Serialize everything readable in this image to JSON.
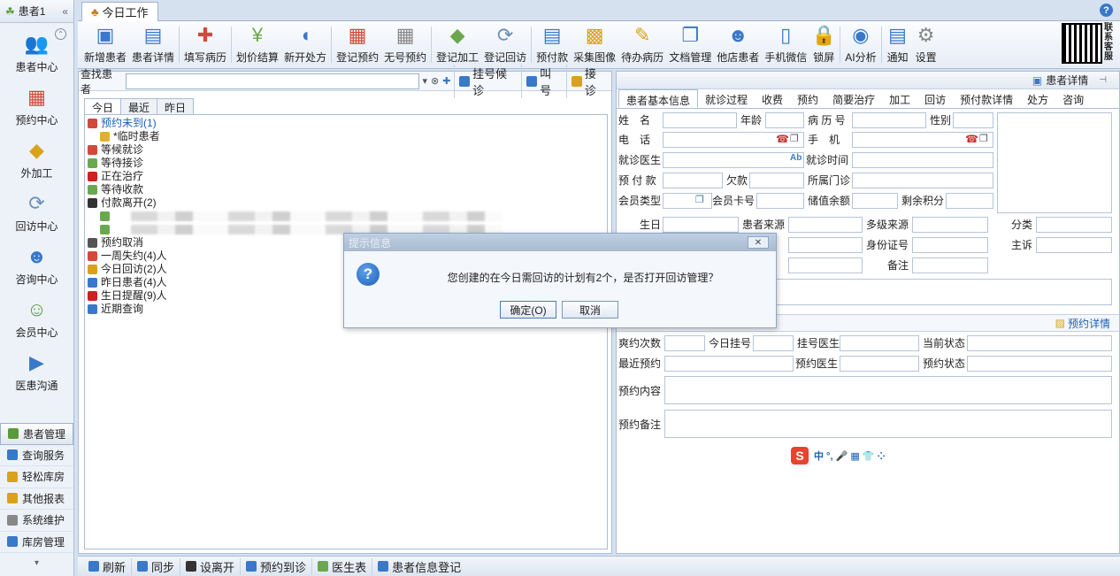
{
  "sidebar": {
    "header": "患者1",
    "collapse": "«",
    "big_items": [
      {
        "label": "患者中心",
        "icon": "patients-icon"
      },
      {
        "label": "预约中心",
        "icon": "calendar-icon"
      },
      {
        "label": "外加工",
        "icon": "boxes-icon"
      },
      {
        "label": "回访中心",
        "icon": "refresh-icon"
      },
      {
        "label": "咨询中心",
        "icon": "consultant-icon"
      },
      {
        "label": "会员中心",
        "icon": "members-icon"
      },
      {
        "label": "医患沟通",
        "icon": "video-icon"
      }
    ],
    "small_items": [
      {
        "label": "患者管理",
        "color": "#5b9a3c",
        "active": true
      },
      {
        "label": "查询服务",
        "color": "#3a78c9",
        "active": false
      },
      {
        "label": "轻松库房",
        "color": "#d9a21a",
        "active": false
      },
      {
        "label": "其他报表",
        "color": "#d9a21a",
        "active": false
      },
      {
        "label": "系统维护",
        "color": "#888888",
        "active": false
      },
      {
        "label": "库房管理",
        "color": "#3a78c9",
        "active": false
      }
    ]
  },
  "tab": {
    "label": "今日工作"
  },
  "toolbar": {
    "buttons": [
      {
        "label": "新增患者",
        "icon": "add-patient-icon"
      },
      {
        "label": "患者详情",
        "icon": "patient-detail-icon"
      },
      {
        "label": "填写病历",
        "icon": "medical-record-icon"
      },
      {
        "label": "划价结算",
        "icon": "yen-icon"
      },
      {
        "label": "新开处方",
        "icon": "pill-icon"
      },
      {
        "label": "登记预约",
        "icon": "calendar-add-icon"
      },
      {
        "label": "无号预约",
        "icon": "calendar-blank-icon"
      },
      {
        "label": "登记加工",
        "icon": "process-icon"
      },
      {
        "label": "登记回访",
        "icon": "revisit-icon"
      },
      {
        "label": "预付款",
        "icon": "prepay-icon"
      },
      {
        "label": "采集图像",
        "icon": "image-icon"
      },
      {
        "label": "待办病历",
        "icon": "todo-icon"
      },
      {
        "label": "文档管理",
        "icon": "document-icon"
      },
      {
        "label": "他店患者",
        "icon": "other-store-icon"
      },
      {
        "label": "手机微信",
        "icon": "phone-icon"
      },
      {
        "label": "锁屏",
        "icon": "lock-icon"
      },
      {
        "label": "AI分析",
        "icon": "eye-icon"
      },
      {
        "label": "通知",
        "icon": "notice-icon"
      },
      {
        "label": "设置",
        "icon": "gear-icon"
      }
    ],
    "qr_label": "联系客服"
  },
  "search": {
    "label": "查找患者",
    "value": "",
    "buttons": [
      {
        "label": "挂号候诊",
        "color": "#3a78c9"
      },
      {
        "label": "叫号",
        "color": "#3a78c9"
      },
      {
        "label": "接诊",
        "color": "#d9a21a"
      }
    ]
  },
  "inner_tabs": [
    "今日",
    "最近",
    "昨日"
  ],
  "tree": [
    {
      "label": "预约未到(1)",
      "color": "#d04a3a",
      "link": true,
      "sub": false
    },
    {
      "label": "*临时患者",
      "color": "#e0b030",
      "link": false,
      "sub": true
    },
    {
      "label": "等候就诊",
      "color": "#d04a3a",
      "link": false,
      "sub": false
    },
    {
      "label": "等待接诊",
      "color": "#6aa84f",
      "link": false,
      "sub": false
    },
    {
      "label": "正在治疗",
      "color": "#cc2222",
      "link": false,
      "sub": false
    },
    {
      "label": "等待收款",
      "color": "#6aa84f",
      "link": false,
      "sub": false
    },
    {
      "label": "付款离开(2)",
      "color": "#333333",
      "link": false,
      "sub": false
    },
    {
      "label": "",
      "color": "#6aa84f",
      "link": false,
      "sub": true,
      "blur": true
    },
    {
      "label": "",
      "color": "#6aa84f",
      "link": false,
      "sub": true,
      "blur": true
    },
    {
      "label": "预约取消",
      "color": "#555555",
      "link": false,
      "sub": false
    },
    {
      "label": "一周失约(4)人",
      "color": "#d04a3a",
      "link": false,
      "sub": false
    },
    {
      "label": "今日回访(2)人",
      "color": "#d9a21a",
      "link": false,
      "sub": false
    },
    {
      "label": "昨日患者(4)人",
      "color": "#3a78c9",
      "link": false,
      "sub": false
    },
    {
      "label": "生日提醒(9)人",
      "color": "#cc2222",
      "link": false,
      "sub": false
    },
    {
      "label": "近期查询",
      "color": "#3a78c9",
      "link": false,
      "sub": false
    }
  ],
  "right": {
    "header": "患者详情",
    "tabs": [
      "患者基本信息",
      "就诊过程",
      "收费",
      "预约",
      "简要治疗",
      "加工",
      "回访",
      "预付款详情",
      "处方",
      "咨询"
    ],
    "fields": {
      "name": "姓　名",
      "age": "年龄",
      "record_no": "病 历 号",
      "gender": "性别",
      "phone": "电　话",
      "mobile": "手　机",
      "doctor": "就诊医生",
      "visit_time": "就诊时间",
      "prepay": "预 付 款",
      "debt": "欠款",
      "clinic": "所属门诊",
      "member_type": "会员类型",
      "member_card": "会员卡号",
      "balance": "储值余额",
      "points": "剩余积分",
      "birthday": "生日",
      "source": "患者来源",
      "source2": "多级来源",
      "category": "分类",
      "id_no": "身份证号",
      "complaint": "主诉",
      "remark": "备注"
    },
    "appointment": {
      "header": "预约详情",
      "count": "爽约次数",
      "today_reg": "今日挂号",
      "reg_doctor": "挂号医生",
      "status": "当前状态",
      "recent": "最近预约",
      "appt_doctor": "预约医生",
      "appt_status": "预约状态",
      "content": "预约内容",
      "note": "预约备注"
    },
    "ime": "中 °, 🎤 ▦ 👕 ⁘"
  },
  "statusbar": [
    {
      "label": "刷新",
      "color": "#3a78c9"
    },
    {
      "label": "同步",
      "color": "#3a78c9"
    },
    {
      "label": "设离开",
      "color": "#333333"
    },
    {
      "label": "预约到诊",
      "color": "#3a78c9"
    },
    {
      "label": "医生表",
      "color": "#6aa84f"
    },
    {
      "label": "患者信息登记",
      "color": "#3a78c9"
    }
  ],
  "dialog": {
    "title": "提示信息",
    "message": "您创建的在今日需回访的计划有2个，是否打开回访管理？",
    "ok": "确定(O)",
    "cancel": "取消"
  }
}
